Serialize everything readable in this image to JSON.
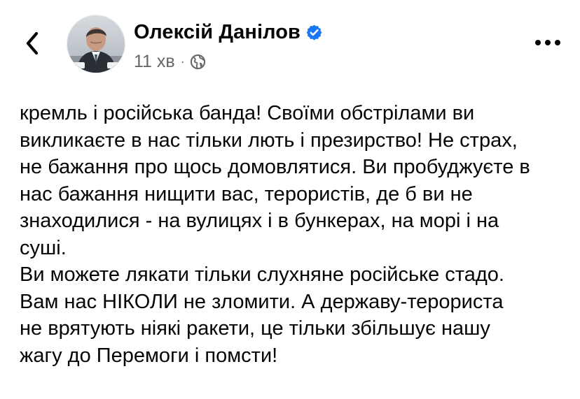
{
  "post": {
    "author_name": "Олексій Данілов",
    "time": "11 хв",
    "separator": "·",
    "audience_icon": "globe-icon",
    "verified_icon": "verified-badge-icon",
    "back_icon": "chevron-left-icon",
    "more_icon": "more-horizontal-icon",
    "lines": [
      "кремль і російська банда! Своїми обстрілами ви",
      "викликаєте в нас тільки лють і презирство! Не страх,",
      "не бажання про щось домовлятися. Ви пробуджуєте в",
      "нас бажання нищити вас, терористів, де б ви не",
      "знаходилися - на вулицях і в бункерах, на морі і на",
      "суші.",
      "Ви можете лякати тільки слухняне російське стадо.",
      "Вам нас НІКОЛИ не зломити. А державу-терориста",
      "не врятують ніякі ракети, це тільки збільшує нашу",
      "жагу до Перемоги і помсти!"
    ]
  },
  "colors": {
    "text_primary": "#050505",
    "text_secondary": "#65676b",
    "verified_blue": "#1877f2",
    "background": "#ffffff"
  }
}
